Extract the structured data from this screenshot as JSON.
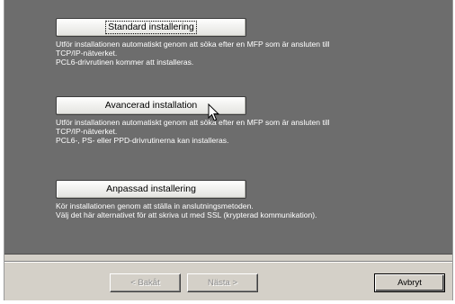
{
  "options": [
    {
      "label": "Standard installering",
      "desc_lines": [
        "Utför installationen automatiskt genom att söka efter en MFP som är ansluten till",
        "TCP/IP-nätverket.",
        "PCL6-drivrutinen kommer att installeras."
      ]
    },
    {
      "label": "Avancerad installation",
      "desc_lines": [
        "Utför installationen automatiskt genom att söka efter en MFP som är ansluten till",
        "TCP/IP-nätverket.",
        "PCL6-, PS- eller PPD-drivrutinerna kan installeras."
      ]
    },
    {
      "label": "Anpassad installering",
      "desc_lines": [
        "Kör installationen genom att ställa in anslutningsmetoden.",
        "Välj det här alternativet för att skriva ut med SSL (krypterad kommunikation)."
      ]
    }
  ],
  "nav": {
    "back_label": "< Bakåt",
    "next_label": "Nästa >",
    "cancel_label": "Avbryt"
  },
  "colors": {
    "panel": "#6d6d6d",
    "dialog": "#d4d0c8",
    "text_on_panel": "#ffffff"
  },
  "icons": {
    "pointer": "mouse-pointer-icon"
  }
}
